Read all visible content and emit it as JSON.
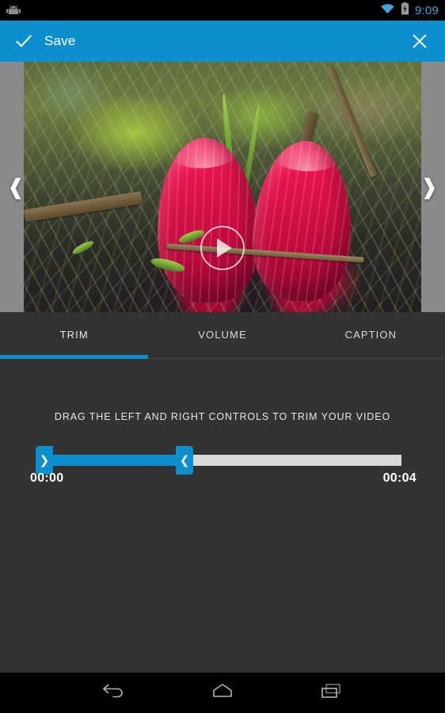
{
  "statusbar": {
    "app_icon": "android-robot-icon",
    "wifi_icon": "wifi-icon",
    "battery_icon": "battery-charging-icon",
    "time": "9:09",
    "time_color": "#3ba7dd"
  },
  "actionbar": {
    "accent_color": "#0d8ecf",
    "check_icon": "checkmark-icon",
    "save_label": "Save",
    "close_icon": "close-x-icon"
  },
  "preview": {
    "prev_arrow": "❰",
    "next_arrow": "❱",
    "play_icon": "play-triangle-icon",
    "letterbox_color": "#8a8a8a"
  },
  "tabs": {
    "items": [
      {
        "label": "TRIM",
        "active": true
      },
      {
        "label": "VOLUME",
        "active": false
      },
      {
        "label": "CAPTION",
        "active": false
      }
    ],
    "indicator_color": "#0d8ecf",
    "bar_color": "#333333"
  },
  "trim": {
    "hint": "DRAG THE LEFT AND RIGHT CONTROLS TO TRIM YOUR VIDEO",
    "handle_left_glyph": "❯",
    "handle_right_glyph": "❮",
    "start_time": "00:00",
    "end_time": "00:04",
    "selection_color": "#0d8ecf",
    "track_color": "#d9d9d9"
  },
  "navbar": {
    "back_icon": "back-arrow-icon",
    "home_icon": "home-icon",
    "recents_icon": "recents-icon"
  }
}
